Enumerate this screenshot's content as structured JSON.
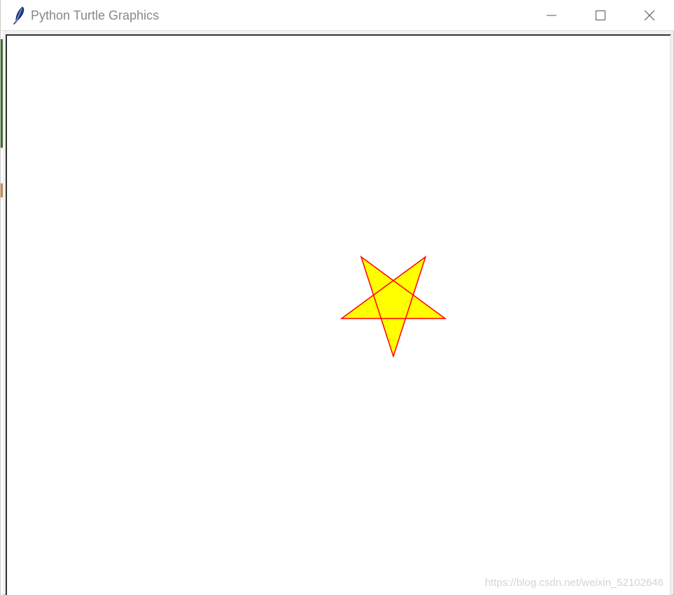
{
  "window": {
    "title": "Python Turtle Graphics",
    "icon": "feather-icon",
    "controls": {
      "minimize": "minimize-icon",
      "maximize": "maximize-icon",
      "close": "close-icon"
    }
  },
  "canvas": {
    "shape": "star",
    "fill_color": "#ffff00",
    "stroke_color": "#ff0000"
  },
  "watermark": "https://blog.csdn.net/weixin_52102646"
}
